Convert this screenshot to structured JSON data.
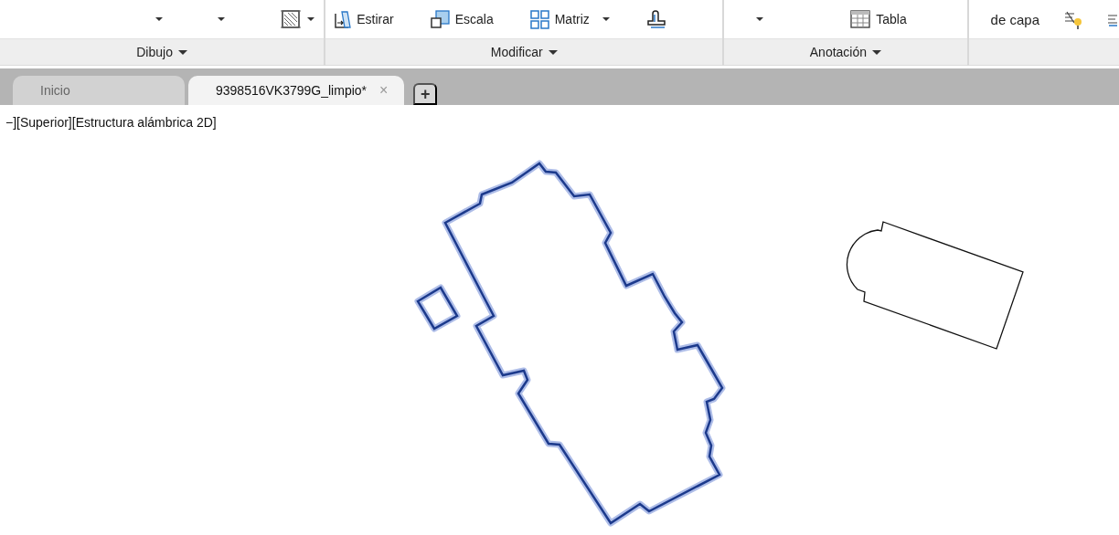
{
  "ribbon": {
    "panels": [
      {
        "label": "Dibujo",
        "items": [
          {
            "kind": "arrow"
          },
          {
            "kind": "arrow"
          },
          {
            "kind": "tool",
            "menu": true
          }
        ]
      },
      {
        "label": "Modificar",
        "items": [
          {
            "kind": "command",
            "label": "Estirar",
            "menu": false
          },
          {
            "kind": "command",
            "label": "Escala",
            "menu": false
          },
          {
            "kind": "command",
            "label": "Matriz",
            "menu": true
          },
          {
            "kind": "tool",
            "menu": false
          }
        ]
      },
      {
        "label": "Anotación",
        "items": [
          {
            "kind": "arrow"
          },
          {
            "kind": "command",
            "label": "Tabla",
            "menu": false
          }
        ]
      },
      {
        "items": [
          {
            "kind": "text",
            "label": "de capa"
          },
          {
            "kind": "tool",
            "menu": false
          },
          {
            "kind": "tool",
            "menu": false
          }
        ]
      }
    ]
  },
  "tabs": [
    {
      "label": "Inicio",
      "selected": false
    },
    {
      "label": "9398516VK3799G_limpio*",
      "selected": true,
      "close": "×"
    }
  ],
  "new_tab": "+",
  "viewport": {
    "label": "−][Superior][Estructura alámbrica 2D]"
  }
}
